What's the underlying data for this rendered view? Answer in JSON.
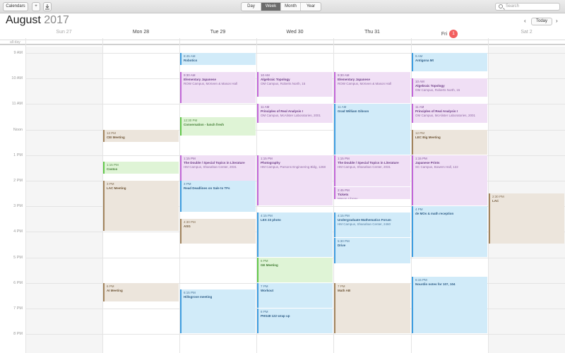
{
  "toolbar": {
    "calendars_label": "Calendars",
    "add_label": "+",
    "views": [
      "Day",
      "Week",
      "Month",
      "Year"
    ],
    "active_view": "Week",
    "search_placeholder": "Search"
  },
  "header": {
    "month": "August",
    "year": "2017",
    "today_label": "Today",
    "prev_icon": "chevron-left-icon",
    "next_icon": "chevron-right-icon"
  },
  "days": [
    {
      "label": "Sun 27"
    },
    {
      "label": "Mon 28"
    },
    {
      "label": "Tue 29"
    },
    {
      "label": "Wed 30"
    },
    {
      "label": "Thu 31"
    },
    {
      "label": "Fri",
      "badge": "1"
    },
    {
      "label": "Sat 2"
    }
  ],
  "allday_label": "all-day",
  "hours": [
    "9 AM",
    "10 AM",
    "11 AM",
    "Noon",
    "1 PM",
    "2 PM",
    "3 PM",
    "4 PM",
    "5 PM",
    "6 PM",
    "7 PM",
    "8 PM"
  ],
  "colors": {
    "blue": "#3e9de0",
    "purple": "#c267d8",
    "green": "#62c84b",
    "brown": "#a2845e",
    "today_badge": "#f25e5e"
  },
  "events": [
    {
      "day": 1,
      "time": "12 PM",
      "name": "CEI Meeting",
      "loc": "",
      "color": "brown",
      "start": 12.0,
      "end": 12.5
    },
    {
      "day": 1,
      "time": "1:15 PM",
      "name": "Costco",
      "loc": "",
      "color": "green",
      "start": 13.25,
      "end": 13.75
    },
    {
      "day": 1,
      "time": "3 PM",
      "name": "LAC Meeting",
      "loc": "",
      "color": "brown",
      "start": 14.0,
      "end": 16.0
    },
    {
      "day": 1,
      "time": "6 PM",
      "name": "AI Meeting",
      "loc": "",
      "color": "brown",
      "start": 18.0,
      "end": 18.75
    },
    {
      "day": 2,
      "time": "8:45 AM",
      "name": "Robotics",
      "loc": "",
      "color": "blue",
      "start": 9.0,
      "end": 9.5
    },
    {
      "day": 2,
      "time": "9:30 AM",
      "name": "Elementary Japanese",
      "loc": "ROW  Campus, McKeen & Mason Hall",
      "color": "purple",
      "start": 9.75,
      "end": 11.0
    },
    {
      "day": 2,
      "time": "12:30 PM",
      "name": "Conversation - lunch fresh",
      "loc": "",
      "color": "green",
      "start": 11.5,
      "end": 12.25
    },
    {
      "day": 2,
      "time": "1:15 PM",
      "name": "The Double / Special Topics in Literature",
      "loc": "HM  Campus, Shanahan Center, 2031",
      "color": "purple",
      "start": 13.0,
      "end": 14.25
    },
    {
      "day": 2,
      "time": "3 PM",
      "name": "Read Deadlines on Sale to TFs",
      "loc": "",
      "color": "blue",
      "start": 14.0,
      "end": 15.25
    },
    {
      "day": 2,
      "time": "4:30 PM",
      "name": "ASG",
      "loc": "",
      "color": "brown",
      "start": 15.5,
      "end": 16.5
    },
    {
      "day": 2,
      "time": "6:15 PM",
      "name": "Hillsgrove meeting",
      "loc": "",
      "color": "blue",
      "start": 18.25,
      "end": 20.0
    },
    {
      "day": 3,
      "time": "10 AM",
      "name": "Algebraic Topology",
      "loc": "OM  Campus, Roberts North, 15",
      "color": "purple",
      "start": 9.75,
      "end": 10.75
    },
    {
      "day": 3,
      "time": "11 AM",
      "name": "Principles of Real Analysis I",
      "loc": "OM  Campus, McAlister Laboratories, 2001",
      "color": "purple",
      "start": 11.0,
      "end": 11.75
    },
    {
      "day": 3,
      "time": "1:15 PM",
      "name": "Photography",
      "loc": "HM  Campus, Parsons Engineering Bldg, 1268",
      "color": "purple",
      "start": 13.0,
      "end": 15.0
    },
    {
      "day": 3,
      "time": "4:15 PM",
      "name": "LEX 23 photo",
      "loc": "",
      "color": "blue",
      "start": 15.25,
      "end": 17.0
    },
    {
      "day": 3,
      "time": "6 PM",
      "name": "GE Meeting",
      "loc": "",
      "color": "green",
      "start": 17.0,
      "end": 18.0
    },
    {
      "day": 3,
      "time": "7 PM",
      "name": "Workout",
      "loc": "",
      "color": "blue",
      "start": 18.0,
      "end": 19.0
    },
    {
      "day": 3,
      "time": "8 PM",
      "name": "PHS48 122 wrap up",
      "loc": "",
      "color": "blue",
      "start": 19.0,
      "end": 20.0
    },
    {
      "day": 4,
      "time": "9:30 AM",
      "name": "Elementary Japanese",
      "loc": "ROW  Campus, McKeen & Mason Hall",
      "color": "purple",
      "start": 9.75,
      "end": 11.0
    },
    {
      "day": 4,
      "time": "11 AM",
      "name": "Grad William Gibson",
      "loc": "",
      "color": "blue",
      "start": 11.0,
      "end": 13.0
    },
    {
      "day": 4,
      "time": "1:15 PM",
      "name": "The Double / Special Topics in Literature",
      "loc": "HM  Campus, Shanahan Center, 2031",
      "color": "purple",
      "start": 13.0,
      "end": 14.25
    },
    {
      "day": 4,
      "time": "2:45 PM",
      "name": "Tickets",
      "loc": "Mason Library",
      "color": "purple",
      "start": 14.25,
      "end": 14.75
    },
    {
      "day": 4,
      "time": "4:15 PM",
      "name": "Undergraduate Mathematics Forum",
      "loc": "HM  Campus, Shanahan Center, 2460",
      "color": "blue",
      "start": 15.25,
      "end": 16.25
    },
    {
      "day": 4,
      "time": "5:30 PM",
      "name": "Drive",
      "loc": "",
      "color": "blue",
      "start": 16.25,
      "end": 17.25
    },
    {
      "day": 4,
      "time": "7 PM",
      "name": "Math AB",
      "loc": "",
      "color": "brown",
      "start": 18.0,
      "end": 20.0
    },
    {
      "day": 5,
      "time": "9 AM",
      "name": "Antigona Mt",
      "loc": "",
      "color": "blue",
      "start": 9.0,
      "end": 9.75
    },
    {
      "day": 5,
      "time": "10 AM",
      "name": "Algebraic Topology",
      "loc": "OM  Campus, Roberts North, 15",
      "color": "purple",
      "start": 10.0,
      "end": 10.75
    },
    {
      "day": 5,
      "time": "11 AM",
      "name": "Principles of Real Analysis I",
      "loc": "OM  Campus, McAlister Laboratories, 2001",
      "color": "purple",
      "start": 11.0,
      "end": 11.75
    },
    {
      "day": 5,
      "time": "12 PM",
      "name": "LEC Big Meeting",
      "loc": "",
      "color": "brown",
      "start": 12.0,
      "end": 13.0
    },
    {
      "day": 5,
      "time": "1:15 PM",
      "name": "Japanese Prints",
      "loc": "SC  Campus, Bowers Hall, 122",
      "color": "purple",
      "start": 13.0,
      "end": 15.0
    },
    {
      "day": 5,
      "time": "4 PM",
      "name": "de MOs & math reception",
      "loc": "",
      "color": "blue",
      "start": 15.0,
      "end": 17.0
    },
    {
      "day": 5,
      "time": "6:15 PM",
      "name": "Nourdin notes for 107, 104",
      "loc": "",
      "color": "blue",
      "start": 17.75,
      "end": 20.0
    },
    {
      "day": 6,
      "time": "2:30 PM",
      "name": "LAC",
      "loc": "",
      "color": "brown",
      "start": 14.5,
      "end": 16.5
    }
  ]
}
